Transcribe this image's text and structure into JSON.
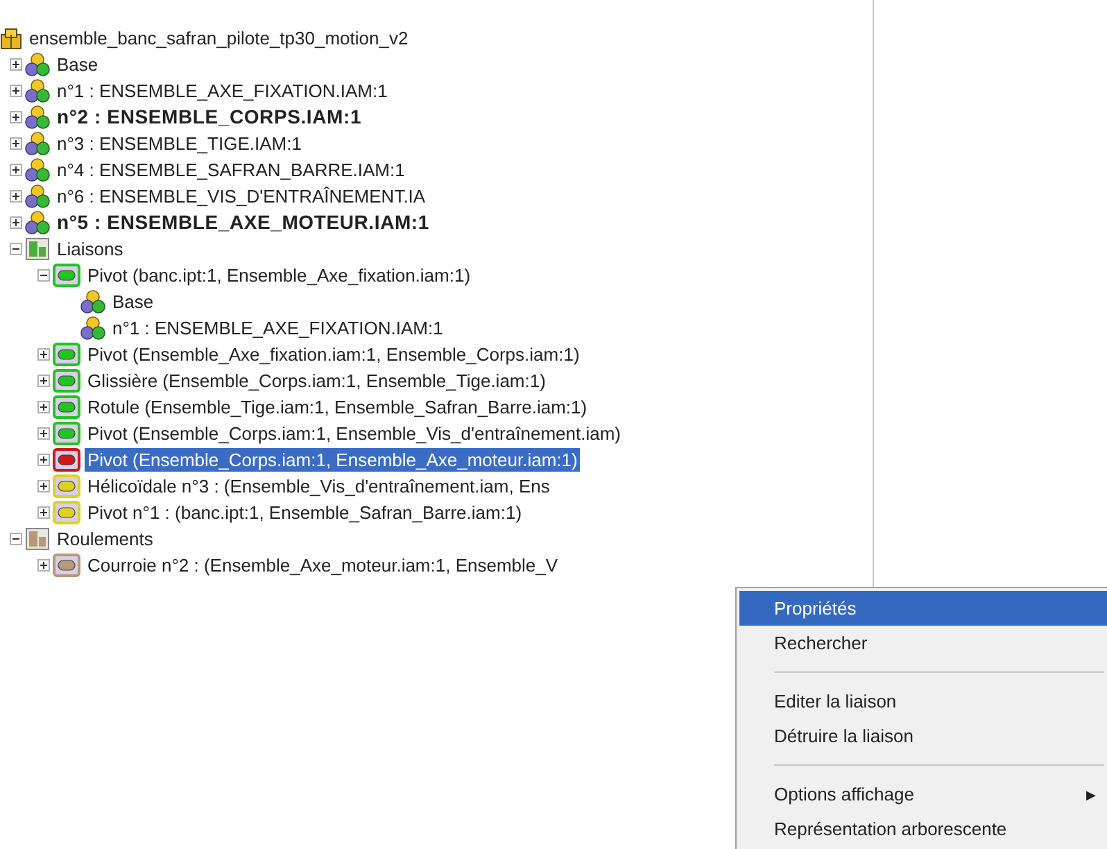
{
  "tree": [
    {
      "label": "ensemble_banc_safran_pilote_tp30_motion_v2",
      "kind": "root",
      "bold": false,
      "selected": false,
      "children": [
        {
          "label": "Base",
          "kind": "assembly",
          "expanded": false,
          "bold": false,
          "selected": false
        },
        {
          "label": "n°1 : ENSEMBLE_AXE_FIXATION.IAM:1",
          "kind": "assembly",
          "expanded": false,
          "bold": false,
          "selected": false
        },
        {
          "label": "n°2 : ENSEMBLE_CORPS.IAM:1",
          "kind": "assembly",
          "expanded": false,
          "bold": true,
          "selected": false
        },
        {
          "label": "n°3 : ENSEMBLE_TIGE.IAM:1",
          "kind": "assembly",
          "expanded": false,
          "bold": false,
          "selected": false
        },
        {
          "label": "n°4 : ENSEMBLE_SAFRAN_BARRE.IAM:1",
          "kind": "assembly",
          "expanded": false,
          "bold": false,
          "selected": false
        },
        {
          "label": "n°6 : ENSEMBLE_VIS_D'ENTRAÎNEMENT.IA",
          "kind": "assembly",
          "expanded": false,
          "bold": false,
          "selected": false
        },
        {
          "label": "n°5 : ENSEMBLE_AXE_MOTEUR.IAM:1",
          "kind": "assembly",
          "expanded": false,
          "bold": true,
          "selected": false
        },
        {
          "label": "Liaisons",
          "kind": "folder",
          "color": "#4caf3a",
          "expanded": true,
          "bold": false,
          "selected": false,
          "children": [
            {
              "label": "Pivot (banc.ipt:1, Ensemble_Axe_fixation.iam:1)",
              "kind": "joint",
              "color": "#22c422",
              "expanded": true,
              "bold": false,
              "selected": false,
              "children": [
                {
                  "label": "Base",
                  "kind": "assembly",
                  "bold": false,
                  "selected": false
                },
                {
                  "label": "n°1 : ENSEMBLE_AXE_FIXATION.IAM:1",
                  "kind": "assembly",
                  "bold": false,
                  "selected": false
                }
              ]
            },
            {
              "label": "Pivot (Ensemble_Axe_fixation.iam:1, Ensemble_Corps.iam:1)",
              "kind": "joint",
              "color": "#22c422",
              "expanded": false,
              "bold": false,
              "selected": false
            },
            {
              "label": "Glissière (Ensemble_Corps.iam:1, Ensemble_Tige.iam:1)",
              "kind": "joint",
              "color": "#22c422",
              "expanded": false,
              "bold": false,
              "selected": false
            },
            {
              "label": "Rotule (Ensemble_Tige.iam:1, Ensemble_Safran_Barre.iam:1)",
              "kind": "joint",
              "color": "#22c422",
              "expanded": false,
              "bold": false,
              "selected": false
            },
            {
              "label": "Pivot (Ensemble_Corps.iam:1, Ensemble_Vis_d'entraînement.iam)",
              "kind": "joint",
              "color": "#22c422",
              "expanded": false,
              "bold": false,
              "selected": false
            },
            {
              "label": "Pivot (Ensemble_Corps.iam:1, Ensemble_Axe_moteur.iam:1)",
              "kind": "joint",
              "color": "#d01818",
              "expanded": false,
              "bold": false,
              "selected": true
            },
            {
              "label": "Hélicoïdale n°3 : (Ensemble_Vis_d'entraînement.iam, Ens",
              "kind": "joint",
              "color": "#e0d020",
              "expanded": false,
              "bold": false,
              "selected": false
            },
            {
              "label": "Pivot n°1 : (banc.ipt:1, Ensemble_Safran_Barre.iam:1)",
              "kind": "joint",
              "color": "#e0d020",
              "expanded": false,
              "bold": false,
              "selected": false
            }
          ]
        },
        {
          "label": "Roulements",
          "kind": "folder",
          "color": "#b89878",
          "expanded": true,
          "bold": false,
          "selected": false,
          "children": [
            {
              "label": "Courroie n°2 : (Ensemble_Axe_moteur.iam:1, Ensemble_V",
              "kind": "joint",
              "color": "#b89878",
              "expanded": false,
              "bold": false,
              "selected": false
            }
          ]
        }
      ]
    }
  ],
  "context_menu": [
    {
      "label": "Propriétés",
      "kind": "item",
      "selected": true
    },
    {
      "label": "Rechercher",
      "kind": "item",
      "selected": false
    },
    {
      "kind": "separator"
    },
    {
      "label": "Editer la liaison",
      "kind": "item",
      "selected": false
    },
    {
      "label": "Détruire la liaison",
      "kind": "item",
      "selected": false
    },
    {
      "kind": "separator"
    },
    {
      "label": "Options affichage",
      "kind": "submenu",
      "selected": false,
      "arrow": "▶"
    },
    {
      "label": "Représentation arborescente",
      "kind": "item",
      "selected": false
    }
  ]
}
